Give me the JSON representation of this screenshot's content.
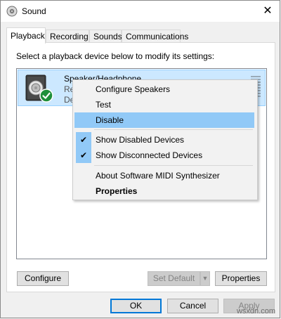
{
  "window": {
    "title": "Sound",
    "close_symbol": "✕"
  },
  "tabs": [
    {
      "label": "Playback",
      "active": true
    },
    {
      "label": "Recording"
    },
    {
      "label": "Sounds"
    },
    {
      "label": "Communications"
    }
  ],
  "playback": {
    "instruction": "Select a playback device below to modify its settings:",
    "device": {
      "name": "Speaker/Headphone",
      "line2": "Re",
      "line3": "De"
    }
  },
  "context_menu": {
    "items": {
      "configure_speakers": "Configure Speakers",
      "test": "Test",
      "disable": "Disable",
      "show_disabled": "Show Disabled Devices",
      "show_disconnected": "Show Disconnected Devices",
      "about_midi": "About Software MIDI Synthesizer",
      "properties": "Properties"
    },
    "check_symbol": "✔"
  },
  "buttons": {
    "configure": "Configure",
    "set_default": "Set Default",
    "set_default_arrow": "▼",
    "properties": "Properties",
    "ok": "OK",
    "cancel": "Cancel",
    "apply": "Apply"
  },
  "watermark": "wsxdn.com",
  "colors": {
    "selection": "#cce8ff",
    "menu_highlight": "#91c9f7",
    "check_badge": "#1e8f3a",
    "accent_border": "#0078d7"
  }
}
